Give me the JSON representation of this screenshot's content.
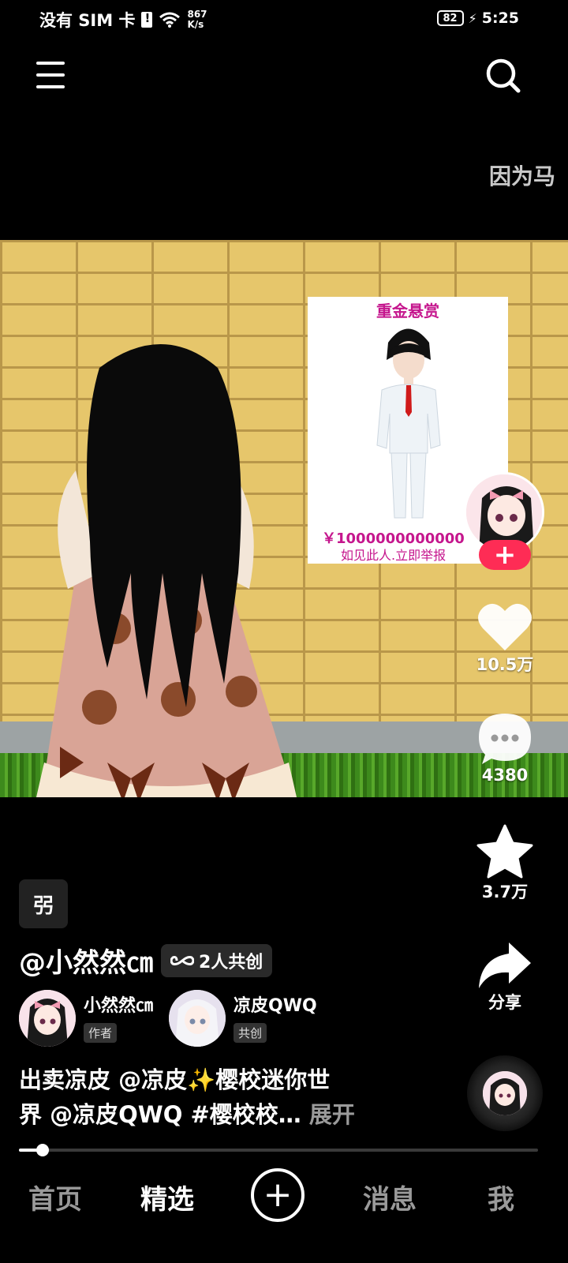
{
  "status_bar": {
    "carrier": "没有 SIM 卡",
    "net_speed_value": "867",
    "net_speed_unit": "K/s",
    "battery": "82",
    "time": "5:25"
  },
  "top": {
    "marquee_text": "因为马"
  },
  "video": {
    "poster_title": "重金悬赏",
    "poster_reward": "￥1000000000000",
    "poster_note": "如见此人.立即举报"
  },
  "rail": {
    "like_count": "10.5万",
    "comment_count": "4380",
    "favorite_count": "3.7万",
    "share_label": "分享",
    "follow_label": "+"
  },
  "info": {
    "music_badge": "弜",
    "author": "@小然然㎝",
    "cocreate": "2人共创",
    "creators": [
      {
        "name": "小然然㎝",
        "role": "作者"
      },
      {
        "name": "凉皮QWQ",
        "role": "共创"
      }
    ],
    "caption_line1": "出卖凉皮 @凉皮✨樱校迷你世",
    "caption_line2": "界 @凉皮QWQ #樱校校…",
    "expand": "展开"
  },
  "progress": 0.045,
  "nav": {
    "home": "首页",
    "featured": "精选",
    "plus": "+",
    "messages": "消息",
    "me": "我"
  },
  "icons": {
    "menu": "menu-icon",
    "search": "search-icon",
    "like": "heart-icon",
    "comment": "comment-icon",
    "favorite": "star-icon",
    "share": "share-icon",
    "cocreate": "infinity-icon"
  },
  "colors": {
    "accent": "#fe2c55",
    "poster_text": "#c5168d",
    "wall": "#e6c66b"
  }
}
